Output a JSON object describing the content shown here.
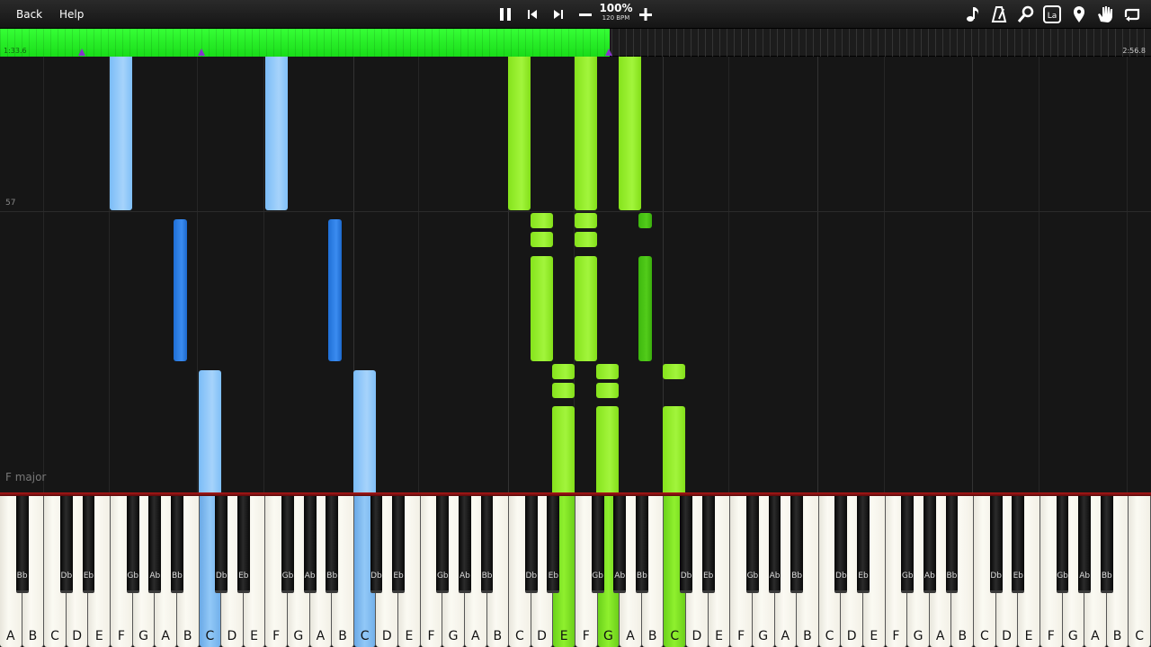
{
  "toolbar": {
    "back_label": "Back",
    "help_label": "Help",
    "speed_percent": "100%",
    "tempo": "120 BPM",
    "icons": [
      "pause-icon",
      "skip-back-icon",
      "skip-forward-icon",
      "minus-icon",
      "plus-icon",
      "note-icon",
      "metronome-icon",
      "zoom-icon",
      "label-icon",
      "location-pin-icon",
      "hand-icon",
      "loop-icon"
    ]
  },
  "progress": {
    "current_time": "1:33.6",
    "total_time": "2:56.8",
    "played_fraction": 0.53,
    "markers_fraction": [
      0.071,
      0.175,
      0.529
    ],
    "fill_color": "#22ee22",
    "marker_color": "#8833cc"
  },
  "roll": {
    "measure_number": "57",
    "key_signature": "F major",
    "colors": {
      "left_hand_light": "#8ec6f9",
      "left_hand_dark": "#2a7ce6",
      "right_hand_light": "#98ee2e",
      "right_hand_dark": "#47c014"
    }
  },
  "keyboard": {
    "white_labels": [
      "A",
      "B",
      "C",
      "D",
      "E",
      "F",
      "G",
      "A",
      "B",
      "C",
      "D",
      "E",
      "F",
      "G",
      "A",
      "B",
      "C",
      "D",
      "E",
      "F",
      "G",
      "A",
      "B",
      "C",
      "D",
      "E",
      "F",
      "G",
      "A",
      "B",
      "C",
      "D",
      "E",
      "F",
      "G",
      "A",
      "B",
      "C",
      "D",
      "E",
      "F",
      "G",
      "A",
      "B",
      "C",
      "D",
      "E",
      "F",
      "G",
      "A",
      "B",
      "C"
    ],
    "black_labels": [
      "Bb",
      "Db",
      "Eb",
      "Gb",
      "Ab",
      "Bb",
      "Db",
      "Eb",
      "Gb",
      "Ab",
      "Bb",
      "Db",
      "Eb",
      "Gb",
      "Ab",
      "Bb",
      "Db",
      "Eb",
      "Gb",
      "Ab",
      "Bb",
      "Db",
      "Eb",
      "Gb",
      "Ab",
      "Bb",
      "Db",
      "Eb",
      "Gb",
      "Ab",
      "Bb",
      "Db",
      "Eb",
      "Gb",
      "Ab",
      "Bb"
    ],
    "pressed": [
      {
        "key": "C",
        "white_index": 9,
        "hand": "left"
      },
      {
        "key": "C",
        "white_index": 16,
        "hand": "left"
      },
      {
        "key": "E",
        "white_index": 25,
        "hand": "right"
      },
      {
        "key": "G",
        "white_index": 27,
        "hand": "right"
      },
      {
        "key": "C",
        "white_index": 30,
        "hand": "right"
      }
    ]
  }
}
